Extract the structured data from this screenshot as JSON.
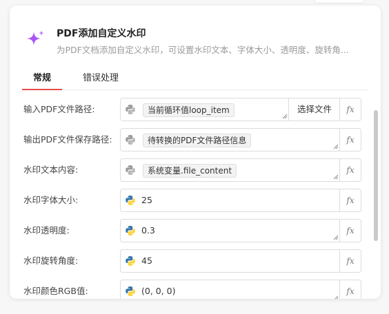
{
  "header": {
    "icon": "sparkle-icon",
    "title": "PDF添加自定义水印",
    "subtitle": "为PDF文档添加自定义水印，可设置水印文本、字体大小、透明度、旋转角..."
  },
  "tabs": [
    {
      "label": "常规",
      "active": true
    },
    {
      "label": "错误处理",
      "active": false
    }
  ],
  "fields": [
    {
      "label": "输入PDF文件路径:",
      "value": "当前循环值loop_item",
      "style": "chip",
      "icon": "python-gray-icon",
      "extra_button": "选择文件",
      "fx": "fx"
    },
    {
      "label": "输出PDF文件保存路径:",
      "value": "待转换的PDF文件路径信息",
      "style": "chip",
      "icon": "python-gray-icon",
      "fx": "fx"
    },
    {
      "label": "水印文本内容:",
      "value": "系统变量.file_content",
      "style": "chip",
      "icon": "python-gray-icon",
      "fx": "fx"
    },
    {
      "label": "水印字体大小:",
      "value": "25",
      "style": "plain",
      "icon": "python-color-icon",
      "fx": "fx"
    },
    {
      "label": "水印透明度:",
      "value": "0.3",
      "style": "plain",
      "icon": "python-color-icon",
      "fx": "fx"
    },
    {
      "label": "水印旋转角度:",
      "value": "45",
      "style": "plain",
      "icon": "python-color-icon",
      "fx": "fx"
    },
    {
      "label": "水印颜色RGB值:",
      "value": "(0, 0, 0)",
      "style": "plain",
      "icon": "python-color-icon",
      "fx": "fx"
    }
  ],
  "colors": {
    "accent": "#e84a4a",
    "sparkle": "#a855f7",
    "python_blue": "#3776ab",
    "python_yellow": "#ffd43b"
  }
}
